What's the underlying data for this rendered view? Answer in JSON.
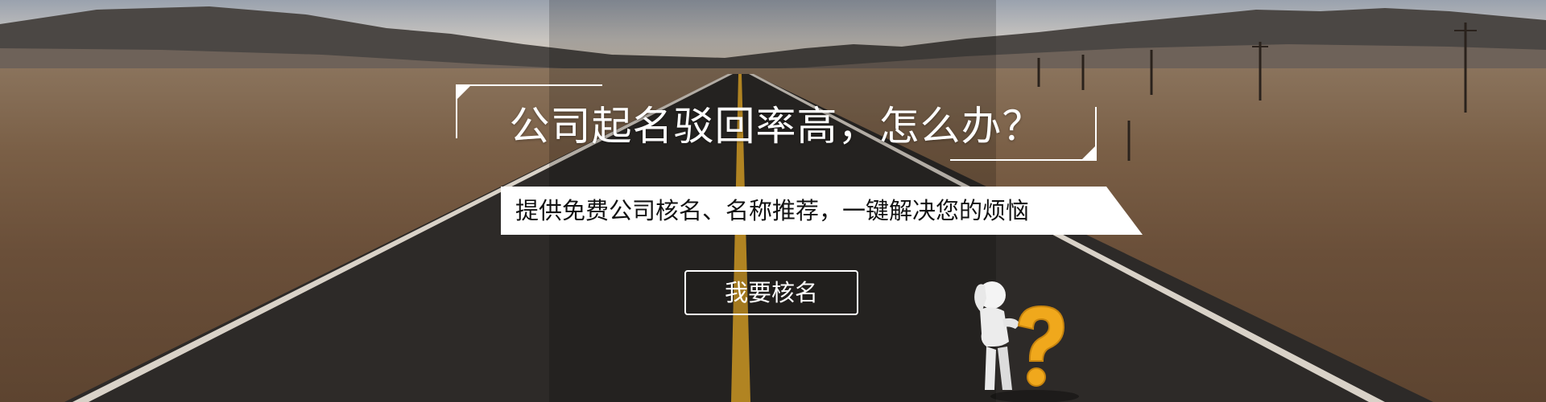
{
  "banner": {
    "headline": "公司起名驳回率高，怎么办？",
    "subtitle": "提供免费公司核名、名称推荐，一键解决您的烦恼",
    "cta_label": "我要核名",
    "figure_icon": "question-mark-figure-icon",
    "colors": {
      "text_light": "#ffffff",
      "ribbon_bg": "#ffffff",
      "ribbon_text": "#111111",
      "road_line": "#d8a12a",
      "question_mark": "#f0a81c"
    }
  }
}
